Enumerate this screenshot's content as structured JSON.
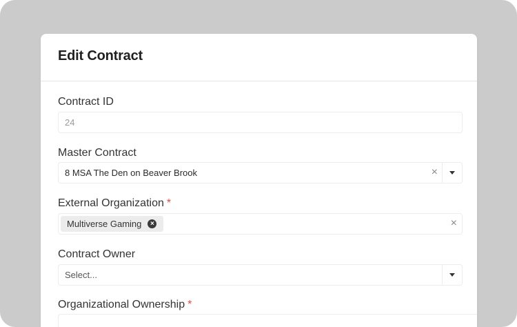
{
  "modal": {
    "title": "Edit Contract"
  },
  "form": {
    "contract_id": {
      "label": "Contract ID",
      "value": "24"
    },
    "master_contract": {
      "label": "Master Contract",
      "value": "8 MSA The Den on Beaver Brook",
      "clear_icon": "×"
    },
    "external_organization": {
      "label": "External Organization",
      "required_mark": "*",
      "tag": "Multiverse Gaming",
      "tag_remove_icon": "×",
      "clear_icon": "×"
    },
    "contract_owner": {
      "label": "Contract Owner",
      "placeholder": "Select..."
    },
    "organizational_ownership": {
      "label": "Organizational Ownership",
      "required_mark": "*"
    }
  },
  "icons": {
    "clear": "close-icon",
    "dropdown": "chevron-down-icon",
    "tag_remove": "remove-circle-icon"
  },
  "colors": {
    "backdrop": "#cbcbcb",
    "required": "#e04b4b",
    "tag_bg": "#ececec"
  }
}
